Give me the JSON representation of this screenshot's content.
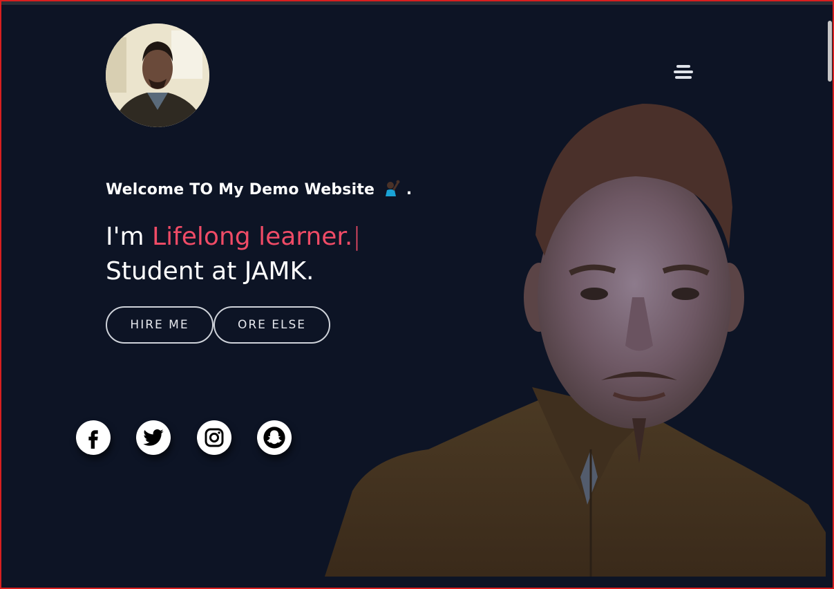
{
  "hero": {
    "welcome": "Welcome TO My Demo Website",
    "welcome_suffix": ".",
    "intro_prefix": "I'm",
    "typed_text": "Lifelong learner.",
    "typing_cursor": "|",
    "subtitle": "Student at JAMK."
  },
  "buttons": {
    "hire": "HIRE ME",
    "else": "ORE ELSE"
  },
  "social": {
    "items": [
      "facebook-icon",
      "twitter-icon",
      "instagram-icon",
      "snapchat-icon"
    ]
  },
  "icons": {
    "menu": "hamburger-menu-icon",
    "wave": "person-raising-hand-icon"
  },
  "colors": {
    "background": "#0d1425",
    "accent": "#ef4b66",
    "text": "#ffffff",
    "button_border": "#cfd3da",
    "window_border": "#d81f1f"
  }
}
